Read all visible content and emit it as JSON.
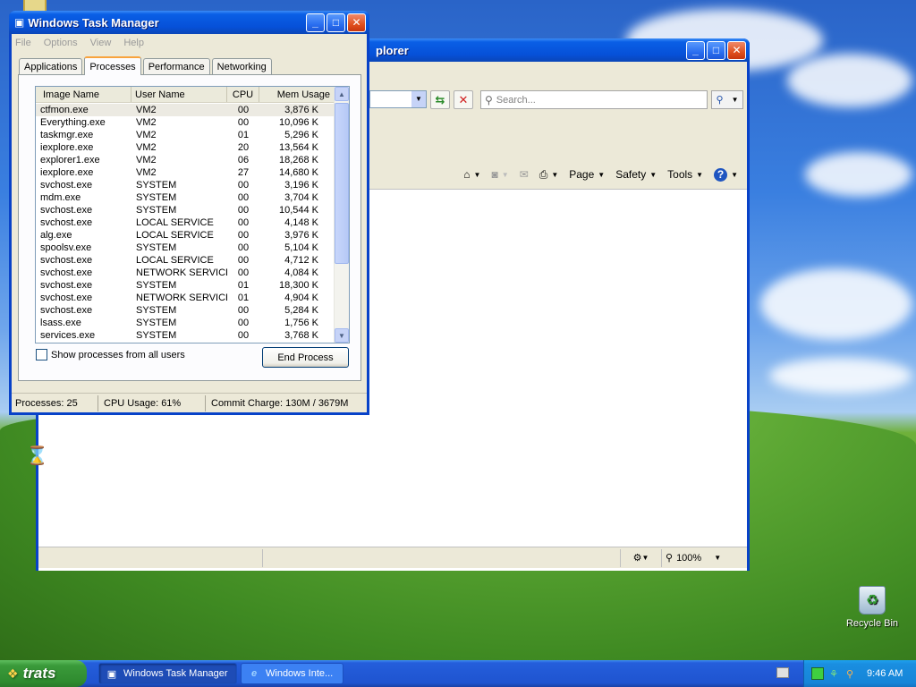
{
  "desktop": {
    "recycle_bin_label": "Recycle Bin"
  },
  "ie_window": {
    "title": "plorer",
    "search_placeholder": "Search...",
    "commands": {
      "page": "Page",
      "safety": "Safety",
      "tools": "Tools"
    },
    "status": {
      "zoom": "100%"
    }
  },
  "task_manager": {
    "title": "Windows Task Manager",
    "menu": [
      "File",
      "Options",
      "View",
      "Help"
    ],
    "tabs": [
      "Applications",
      "Processes",
      "Performance",
      "Networking"
    ],
    "active_tab": "Processes",
    "columns": [
      "Image Name",
      "User Name",
      "CPU",
      "Mem Usage"
    ],
    "processes": [
      {
        "name": "ctfmon.exe",
        "user": "VM2",
        "cpu": "00",
        "mem": "3,876 K"
      },
      {
        "name": "Everything.exe",
        "user": "VM2",
        "cpu": "00",
        "mem": "10,096 K"
      },
      {
        "name": "taskmgr.exe",
        "user": "VM2",
        "cpu": "01",
        "mem": "5,296 K"
      },
      {
        "name": "iexplore.exe",
        "user": "VM2",
        "cpu": "20",
        "mem": "13,564 K"
      },
      {
        "name": "explorer1.exe",
        "user": "VM2",
        "cpu": "06",
        "mem": "18,268 K"
      },
      {
        "name": "iexplore.exe",
        "user": "VM2",
        "cpu": "27",
        "mem": "14,680 K"
      },
      {
        "name": "svchost.exe",
        "user": "SYSTEM",
        "cpu": "00",
        "mem": "3,196 K"
      },
      {
        "name": "mdm.exe",
        "user": "SYSTEM",
        "cpu": "00",
        "mem": "3,704 K"
      },
      {
        "name": "svchost.exe",
        "user": "SYSTEM",
        "cpu": "00",
        "mem": "10,544 K"
      },
      {
        "name": "svchost.exe",
        "user": "LOCAL SERVICE",
        "cpu": "00",
        "mem": "4,148 K"
      },
      {
        "name": "alg.exe",
        "user": "LOCAL SERVICE",
        "cpu": "00",
        "mem": "3,976 K"
      },
      {
        "name": "spoolsv.exe",
        "user": "SYSTEM",
        "cpu": "00",
        "mem": "5,104 K"
      },
      {
        "name": "svchost.exe",
        "user": "LOCAL SERVICE",
        "cpu": "00",
        "mem": "4,712 K"
      },
      {
        "name": "svchost.exe",
        "user": "NETWORK SERVICE",
        "cpu": "00",
        "mem": "4,084 K"
      },
      {
        "name": "svchost.exe",
        "user": "SYSTEM",
        "cpu": "01",
        "mem": "18,300 K"
      },
      {
        "name": "svchost.exe",
        "user": "NETWORK SERVICE",
        "cpu": "01",
        "mem": "4,904 K"
      },
      {
        "name": "svchost.exe",
        "user": "SYSTEM",
        "cpu": "00",
        "mem": "5,284 K"
      },
      {
        "name": "lsass.exe",
        "user": "SYSTEM",
        "cpu": "00",
        "mem": "1,756 K"
      },
      {
        "name": "services.exe",
        "user": "SYSTEM",
        "cpu": "00",
        "mem": "3,768 K"
      }
    ],
    "show_all_label": "Show processes from all users",
    "end_process_label": "End Process",
    "status": {
      "processes": "Processes: 25",
      "cpu": "CPU Usage: 61%",
      "commit": "Commit Charge: 130M / 3679M"
    }
  },
  "taskbar": {
    "start_label": "trats",
    "tasks": [
      "Windows Task Manager",
      "Windows Inte..."
    ],
    "clock": "9:46 AM"
  }
}
